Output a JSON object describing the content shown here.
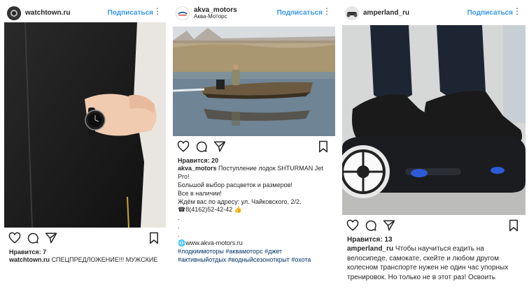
{
  "posts": [
    {
      "username": "watchtown.ru",
      "follow_label": "Подписаться",
      "more_label": "⋮",
      "likes": "Нравится: 7",
      "caption_user": "watchtown.ru",
      "caption_text": "СПЕЦПРЕДЛОЖЕНИЕ!!! МУЖСКИЕ"
    },
    {
      "username": "akva_motors",
      "location": "Аква-Моторс",
      "follow_label": "Подписаться",
      "more_label": "⋮",
      "likes": "Нравится: 20",
      "caption_user": "akva_motors",
      "caption_text": "Поступление лодок SHTURMAN Jet Pro!",
      "lines": [
        "Большой выбор расцветок и размеров!",
        "Все в наличии!",
        "Ждём вас по адресу: ул. Чайковского, 2/2.",
        "☎8(4162)52-42-42 👍",
        ".",
        ".",
        ".",
        "🌐www.akva-motors.ru"
      ],
      "hashtags": "#лодкиимоторы #аквамоторс #джет #активныйотдых #водныйсезоноткрыт #охота"
    },
    {
      "username": "amperland_ru",
      "follow_label": "Подписаться",
      "more_label": "⋮",
      "likes": "Нравится: 13",
      "caption_user": "amperland_ru",
      "caption_text": "Чтобы научиться ездить на велосипеде, самокате, скейте и любом другом колесном транспорте  нужен не один час упорных тренировок. Но только не в этот раз!   Освоить"
    }
  ],
  "colors": {
    "follow": "#3897f0",
    "text": "#262626",
    "hashtag": "#003569"
  },
  "icons": [
    "heart-icon",
    "comment-icon",
    "share-icon",
    "bookmark-icon",
    "more-icon"
  ]
}
